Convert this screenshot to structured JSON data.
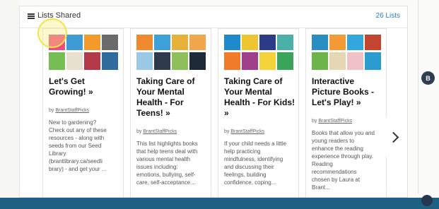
{
  "header": {
    "title": "Lists Shared",
    "count": "26 Lists"
  },
  "cards": [
    {
      "title": "Let's Get Growing! »",
      "by": "by",
      "author": "BrantStaffPicks",
      "description": "New to gardening? Check out any of these resources - along with seeds from our Seed Library (brantlibrary.ca/seedli brary) - and get your ...",
      "covers": [
        "#ee4b84",
        "#3f9bd6",
        "#f39a2a",
        "#6a6a6a",
        "#76bd54",
        "#e8e0cf"
      ]
    },
    {
      "title": "Taking Care of Your Mental Health - For Teens! »",
      "by": "by",
      "author": "BrantStaffPicks",
      "description": "This list highlights books that help teens deal with various mental health issues including: emotions, bullying, self-care, self-acceptance...",
      "covers": [
        "#f08a2e",
        "#3ea0d8",
        "#e6b23a",
        "#f2a64b",
        "#9ac9e6",
        "#2f3a4c"
      ]
    },
    {
      "title": "Taking Care of Your Mental Health - For Kids! »",
      "by": "by",
      "author": "BrantStaffPicks",
      "description": "If your child needs a little help practicing mindfulness, identifying and discussing their feelings, building confidence, coping...",
      "covers": [
        "#1f8acb",
        "#ecc531",
        "#2b3b86",
        "#4ab0a8",
        "#f07b2b",
        "#9f3f8a"
      ]
    },
    {
      "title": "Interactive Picture Books - Let's Play! »",
      "by": "by",
      "author": "BrantStaffPicks",
      "description": "Books that allow you and young readers to enhance the reading experience through play. Reading recommendations chosen by Laura at Brant...",
      "covers": [
        "#2a8ec2",
        "#f39a36",
        "#34a6de",
        "#c4452f",
        "#6cb44b",
        "#e6d7b3"
      ]
    }
  ],
  "avatar": {
    "initial": "B"
  },
  "icons": [
    "list-icon",
    "chevron-right-icon"
  ],
  "colors": {
    "accent": "#2b7cc0",
    "footer": "#1e5f84"
  }
}
